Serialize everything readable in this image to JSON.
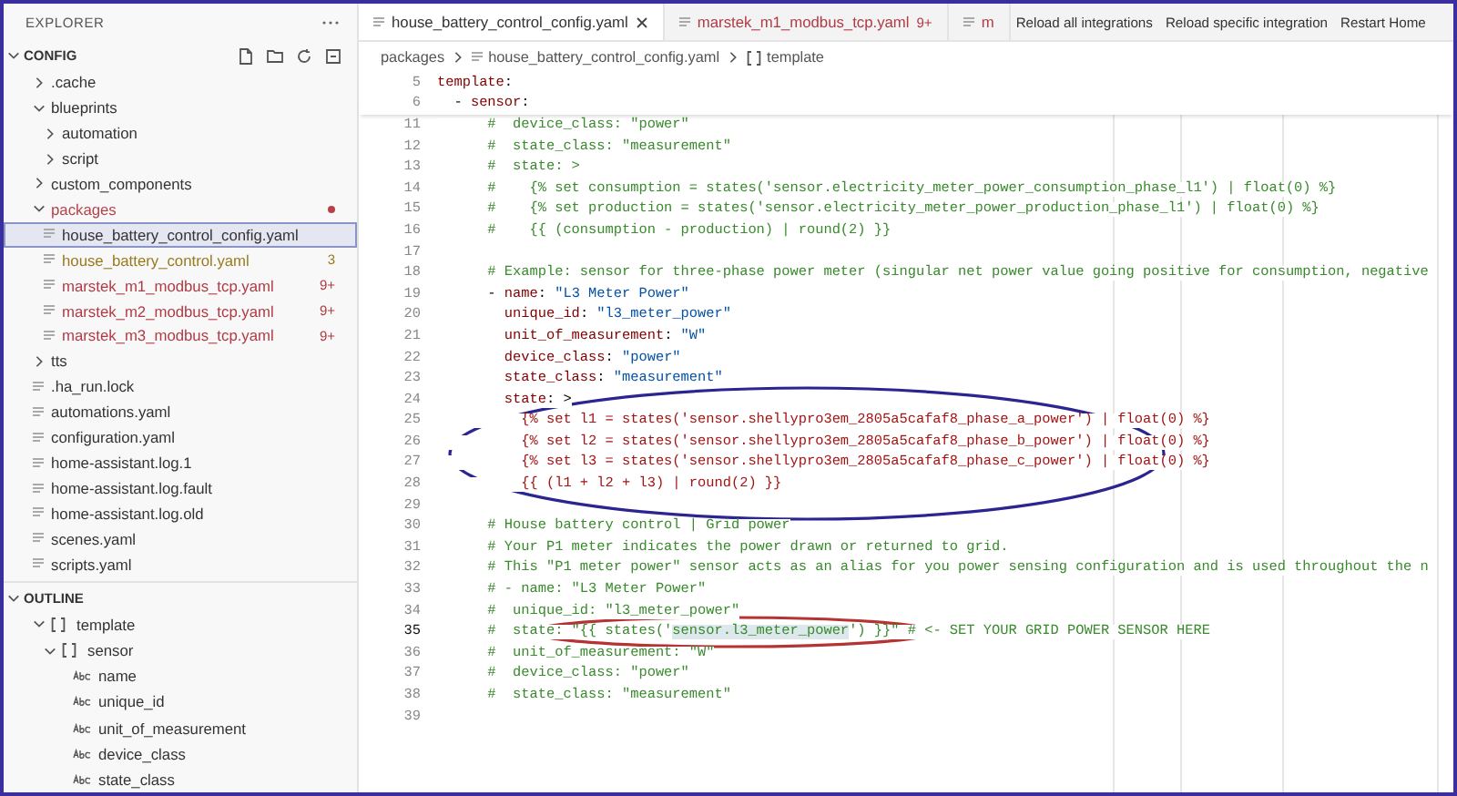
{
  "explorer": {
    "title": "EXPLORER",
    "section": "CONFIG",
    "expanded": true
  },
  "tree": [
    {
      "label": ".cache",
      "kind": "folder",
      "expanded": false,
      "selected": false
    },
    {
      "label": "blueprints",
      "kind": "folder",
      "expanded": true,
      "selected": false,
      "children": [
        {
          "label": "automation",
          "kind": "folder",
          "expanded": false,
          "selected": false
        },
        {
          "label": "script",
          "kind": "folder",
          "expanded": false,
          "selected": false
        }
      ]
    },
    {
      "label": "custom_components",
      "kind": "folder",
      "expanded": false,
      "selected": false
    },
    {
      "label": "packages",
      "kind": "folder",
      "expanded": true,
      "selected": false,
      "color": "#b5424a",
      "dot": true,
      "children": [
        {
          "label": "house_battery_control_config.yaml",
          "kind": "file",
          "selected": true
        },
        {
          "label": "house_battery_control.yaml",
          "kind": "file",
          "selected": false,
          "color": "#9a7a1e",
          "badge": "3"
        },
        {
          "label": "marstek_m1_modbus_tcp.yaml",
          "kind": "file",
          "selected": false,
          "color": "#b03a44",
          "badge": "9+"
        },
        {
          "label": "marstek_m2_modbus_tcp.yaml",
          "kind": "file",
          "selected": false,
          "color": "#b03a44",
          "badge": "9+"
        },
        {
          "label": "marstek_m3_modbus_tcp.yaml",
          "kind": "file",
          "selected": false,
          "color": "#b03a44",
          "badge": "9+"
        }
      ]
    },
    {
      "label": "tts",
      "kind": "folder",
      "expanded": false,
      "selected": false
    },
    {
      "label": ".ha_run.lock",
      "kind": "file",
      "selected": false
    },
    {
      "label": "automations.yaml",
      "kind": "file",
      "selected": false
    },
    {
      "label": "configuration.yaml",
      "kind": "file",
      "selected": false
    },
    {
      "label": "home-assistant.log.1",
      "kind": "file",
      "selected": false
    },
    {
      "label": "home-assistant.log.fault",
      "kind": "file",
      "selected": false
    },
    {
      "label": "home-assistant.log.old",
      "kind": "file",
      "selected": false
    },
    {
      "label": "scenes.yaml",
      "kind": "file",
      "selected": false
    },
    {
      "label": "scripts.yaml",
      "kind": "file",
      "selected": false
    }
  ],
  "outline": {
    "title": "OUTLINE",
    "expanded": true,
    "items": [
      {
        "label": "template",
        "kind": "array",
        "expanded": true,
        "children": [
          {
            "label": "sensor",
            "kind": "array",
            "expanded": true,
            "children": [
              {
                "label": "name",
                "kind": "string"
              },
              {
                "label": "unique_id",
                "kind": "string"
              },
              {
                "label": "unit_of_measurement",
                "kind": "string"
              },
              {
                "label": "device_class",
                "kind": "string"
              },
              {
                "label": "state_class",
                "kind": "string"
              }
            ]
          }
        ]
      }
    ]
  },
  "tabs": [
    {
      "label": "house_battery_control_config.yaml",
      "selected": true,
      "color": "#333333"
    },
    {
      "label": "marstek_m1_modbus_tcp.yaml",
      "selected": false,
      "color": "#b03a44",
      "badge": "9+"
    },
    {
      "label": "m",
      "selected": false,
      "color": "#b03a44"
    }
  ],
  "toolbar": [
    "Reload all integrations",
    "Reload specific integration",
    "Restart Home"
  ],
  "breadcrumb": [
    {
      "label": "packages",
      "kind": "folder"
    },
    {
      "label": "house_battery_control_config.yaml",
      "kind": "file"
    },
    {
      "label": "template",
      "kind": "array"
    }
  ],
  "code": [
    {
      "n": "5",
      "sticky": true,
      "active": false,
      "segs": [
        {
          "kind": "key",
          "text": "template"
        },
        {
          "kind": "plain",
          "text": ":"
        }
      ]
    },
    {
      "n": "6",
      "sticky": true,
      "active": false,
      "segs": [
        {
          "kind": "plain",
          "text": "  - "
        },
        {
          "kind": "key",
          "text": "sensor"
        },
        {
          "kind": "plain",
          "text": ":"
        }
      ]
    },
    {
      "n": "11",
      "active": false,
      "segs": [
        {
          "kind": "comment",
          "text": "      #  device_class: \"power\""
        }
      ]
    },
    {
      "n": "12",
      "active": false,
      "segs": [
        {
          "kind": "comment",
          "text": "      #  state_class: \"measurement\""
        }
      ]
    },
    {
      "n": "13",
      "active": false,
      "segs": [
        {
          "kind": "comment",
          "text": "      #  state: >"
        }
      ]
    },
    {
      "n": "14",
      "active": false,
      "segs": [
        {
          "kind": "comment",
          "text": "      #    {% set consumption = states('sensor.electricity_meter_power_consumption_phase_l1') | float(0) %}"
        }
      ]
    },
    {
      "n": "15",
      "active": false,
      "segs": [
        {
          "kind": "comment",
          "text": "      #    {% set production = states('sensor.electricity_meter_power_production_phase_l1') | float(0) %}"
        }
      ]
    },
    {
      "n": "16",
      "active": false,
      "segs": [
        {
          "kind": "comment",
          "text": "      #    {{ (consumption - production) | round(2) }}"
        }
      ]
    },
    {
      "n": "17",
      "active": false
    },
    {
      "n": "18",
      "active": false,
      "segs": [
        {
          "kind": "comment",
          "text": "      # Example: sensor for three-phase power meter (singular net power value going positive for consumption, negative"
        }
      ]
    },
    {
      "n": "19",
      "active": false,
      "segs": [
        {
          "kind": "plain",
          "text": "      - "
        },
        {
          "kind": "key",
          "text": "name"
        },
        {
          "kind": "plain",
          "text": ": "
        },
        {
          "kind": "string",
          "text": "\"L3 Meter Power\""
        }
      ]
    },
    {
      "n": "20",
      "active": false,
      "segs": [
        {
          "kind": "key",
          "text": "        unique_id"
        },
        {
          "kind": "plain",
          "text": ": "
        },
        {
          "kind": "string",
          "text": "\"l3_meter_power\""
        }
      ]
    },
    {
      "n": "21",
      "active": false,
      "segs": [
        {
          "kind": "key",
          "text": "        unit_of_measurement"
        },
        {
          "kind": "plain",
          "text": ": "
        },
        {
          "kind": "string",
          "text": "\"W\""
        }
      ]
    },
    {
      "n": "22",
      "active": false,
      "segs": [
        {
          "kind": "key",
          "text": "        device_class"
        },
        {
          "kind": "plain",
          "text": ": "
        },
        {
          "kind": "string",
          "text": "\"power\""
        }
      ]
    },
    {
      "n": "23",
      "active": false,
      "segs": [
        {
          "kind": "key",
          "text": "        state_class"
        },
        {
          "kind": "plain",
          "text": ": "
        },
        {
          "kind": "string",
          "text": "\"measurement\""
        }
      ]
    },
    {
      "n": "24",
      "active": false,
      "segs": [
        {
          "kind": "key",
          "text": "        state"
        },
        {
          "kind": "plain",
          "text": ": >"
        }
      ]
    },
    {
      "n": "25",
      "active": false,
      "segs": [
        {
          "kind": "template",
          "text": "          {% set l1 = states('sensor.shellypro3em_2805a5cafaf8_phase_a_power') | float(0) %}"
        }
      ]
    },
    {
      "n": "26",
      "active": false,
      "segs": [
        {
          "kind": "template",
          "text": "          {% set l2 = states('sensor.shellypro3em_2805a5cafaf8_phase_b_power') | float(0) %}"
        }
      ]
    },
    {
      "n": "27",
      "active": false,
      "segs": [
        {
          "kind": "template",
          "text": "          {% set l3 = states('sensor.shellypro3em_2805a5cafaf8_phase_c_power') | float(0) %}"
        }
      ]
    },
    {
      "n": "28",
      "active": false,
      "segs": [
        {
          "kind": "template",
          "text": "          {{ (l1 + l2 + l3) | round(2) }}"
        }
      ]
    },
    {
      "n": "29",
      "active": false
    },
    {
      "n": "30",
      "active": false,
      "segs": [
        {
          "kind": "comment",
          "text": "      # House battery control | Grid power"
        }
      ]
    },
    {
      "n": "31",
      "active": false,
      "segs": [
        {
          "kind": "comment",
          "text": "      # Your P1 meter indicates the power drawn or returned to grid."
        }
      ]
    },
    {
      "n": "32",
      "active": false,
      "segs": [
        {
          "kind": "comment",
          "text": "      # This \"P1 meter power\" sensor acts as an alias for you power sensing configuration and is used throughout the n"
        }
      ]
    },
    {
      "n": "33",
      "active": false,
      "segs": [
        {
          "kind": "comment",
          "text": "      # - name: \"L3 Meter Power\""
        }
      ]
    },
    {
      "n": "34",
      "active": false,
      "segs": [
        {
          "kind": "comment",
          "text": "      #  unique_id: \"l3_meter_power\""
        }
      ]
    },
    {
      "n": "35",
      "active": true,
      "segs": [
        {
          "kind": "comment",
          "text": "      #  state: \"{{ states('"
        },
        {
          "kind": "highlight",
          "text": "sensor.l3_meter_power"
        },
        {
          "kind": "comment",
          "text": "') }}\" # <- SET YOUR GRID POWER SENSOR HERE"
        }
      ]
    },
    {
      "n": "36",
      "active": false,
      "segs": [
        {
          "kind": "comment",
          "text": "      #  unit_of_measurement: \"W\""
        }
      ]
    },
    {
      "n": "37",
      "active": false,
      "segs": [
        {
          "kind": "comment",
          "text": "      #  device_class: \"power\""
        }
      ]
    },
    {
      "n": "38",
      "active": false,
      "segs": [
        {
          "kind": "comment",
          "text": "      #  state_class: \"measurement\""
        }
      ]
    },
    {
      "n": "39",
      "active": false
    }
  ],
  "annotations": [
    {
      "color": "#2a2590"
    },
    {
      "color": "#b53333"
    }
  ]
}
